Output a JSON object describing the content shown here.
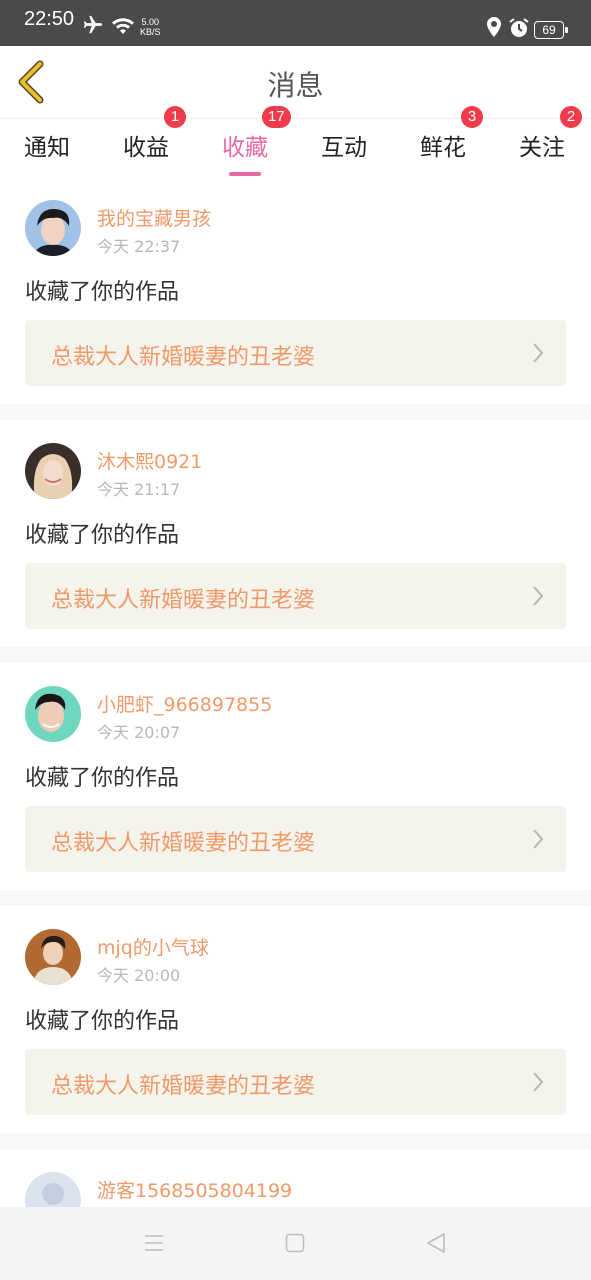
{
  "status_bar": {
    "time": "22:50",
    "net_speed_value": "5.00",
    "net_speed_unit": "KB/S",
    "battery": "69"
  },
  "header": {
    "title": "消息"
  },
  "tabs": [
    {
      "label": "通知",
      "badge": ""
    },
    {
      "label": "收益",
      "badge": "1"
    },
    {
      "label": "收藏",
      "badge": "17",
      "active": true
    },
    {
      "label": "互动",
      "badge": ""
    },
    {
      "label": "鲜花",
      "badge": "3"
    },
    {
      "label": "关注",
      "badge": "2"
    }
  ],
  "notifications": [
    {
      "username": "我的宝藏男孩",
      "time": "今天 22:37",
      "action": "收藏了你的作品",
      "work_title": "总裁大人新婚暖妻的丑老婆"
    },
    {
      "username": "沐木熙0921",
      "time": "今天 21:17",
      "action": "收藏了你的作品",
      "work_title": "总裁大人新婚暖妻的丑老婆"
    },
    {
      "username": "小肥虾_966897855",
      "time": "今天 20:07",
      "action": "收藏了你的作品",
      "work_title": "总裁大人新婚暖妻的丑老婆"
    },
    {
      "username": "mjq的小气球",
      "time": "今天 20:00",
      "action": "收藏了你的作品",
      "work_title": "总裁大人新婚暖妻的丑老婆"
    },
    {
      "username": "游客1568505804199",
      "time": "",
      "action": "",
      "work_title": ""
    }
  ],
  "colors": {
    "accent_pink": "#e86aa4",
    "username_orange": "#f09a6a",
    "badge_red": "#f23b4a",
    "work_box_bg": "#f5f4ec",
    "back_arrow_yellow": "#e8c233"
  },
  "icons": {
    "back": "back-arrow-icon",
    "chevron": "chevron-right-icon",
    "nav_menu": "menu-icon",
    "nav_home": "home-square-icon",
    "nav_back": "back-triangle-icon"
  }
}
